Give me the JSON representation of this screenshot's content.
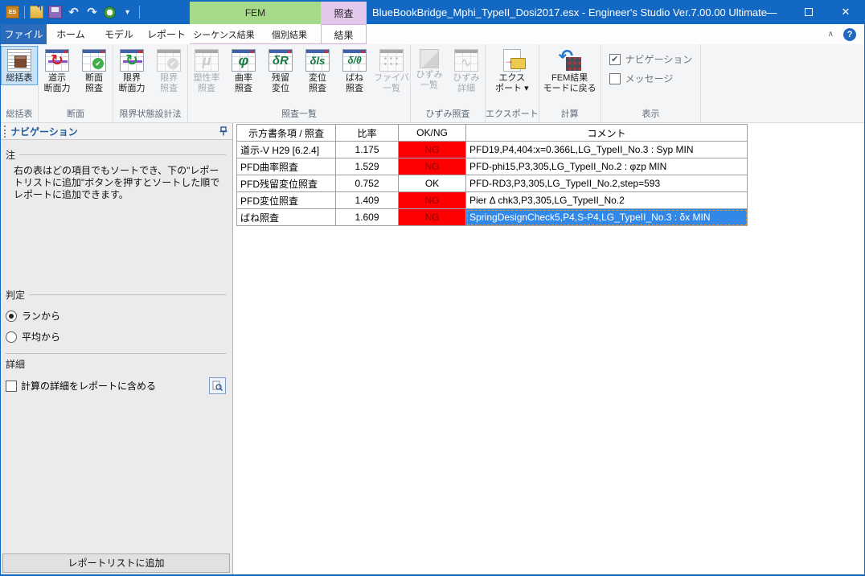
{
  "window": {
    "title": "BlueBookBridge_Mphi_TypeII_Dosi2017.esx - Engineer's Studio Ver.7.00.00 Ultimate",
    "controls": [
      "minimize-button",
      "maximize-button",
      "close-button"
    ]
  },
  "colors": {
    "title_bar": "#1268C2",
    "fem_tab_green": "#A6DA8B",
    "kensa_tab_purple": "#E2C8EA",
    "ng_bg": "#FF0000",
    "ng_text": "#8B0000",
    "selected_cell_bg": "#3188E6",
    "selected_cell_border": "#D98E35"
  },
  "quick_access": {
    "icons": [
      "app-logo-icon",
      "open-file-icon",
      "save-icon",
      "undo-icon",
      "redo-icon",
      "performance-icon",
      "qat-dropdown-icon"
    ]
  },
  "context_tabs": {
    "fem": "FEM",
    "kensa": "照査"
  },
  "tabstrip": {
    "tabs": [
      {
        "label": "ファイル",
        "style": "file"
      },
      {
        "label": "ホーム",
        "style": "normal"
      },
      {
        "label": "モデル",
        "style": "normal"
      },
      {
        "label": "レポート",
        "style": "normal"
      },
      {
        "label": "シーケンス結果",
        "style": "ctx"
      },
      {
        "label": "個別結果",
        "style": "ctx"
      },
      {
        "label": "結果",
        "style": "selected"
      }
    ],
    "collapse_chevron": "∧",
    "help": "?"
  },
  "ribbon": {
    "groups": [
      {
        "label": "総括表",
        "buttons": [
          {
            "label": "総括表",
            "icon": "summary-table-icon",
            "state": "selected"
          }
        ]
      },
      {
        "label": "断面",
        "buttons": [
          {
            "label": "道示\n断面力",
            "icon": "cycle-red-icon",
            "glyph": "↻"
          },
          {
            "label": "断面\n照査",
            "icon": "check-green-icon"
          }
        ]
      },
      {
        "label": "限界状態設計法",
        "buttons": [
          {
            "label": "限界\n断面力",
            "icon": "cycle-green-icon",
            "glyph": "↻"
          },
          {
            "label": "限界\n照査",
            "icon": "check-gray-icon",
            "state": "disabled"
          }
        ]
      },
      {
        "label": "照査一覧",
        "buttons": [
          {
            "label": "塑性率\n照査",
            "icon": "mu-icon",
            "glyph": "μ",
            "state": "disabled"
          },
          {
            "label": "曲率\n照査",
            "icon": "phi-icon",
            "glyph": "φ"
          },
          {
            "label": "残留\n変位",
            "icon": "delta-r-icon",
            "glyph": "δR"
          },
          {
            "label": "変位\n照査",
            "icon": "delta-ls-icon",
            "glyph": "δls"
          },
          {
            "label": "ばね\n照査",
            "icon": "delta-theta-icon",
            "glyph": "δ/θ"
          },
          {
            "label": "ファイバ\n一覧",
            "icon": "fiber-list-icon",
            "state": "disabled"
          }
        ]
      },
      {
        "label": "ひずみ照査",
        "buttons": [
          {
            "label": "ひずみ\n一覧",
            "icon": "strain-list-icon",
            "state": "disabled"
          },
          {
            "label": "ひずみ\n詳細",
            "icon": "strain-detail-icon",
            "state": "disabled"
          }
        ]
      },
      {
        "label": "エクスポート",
        "buttons": [
          {
            "label": "エクス\nポート ▾",
            "icon": "export-icon"
          }
        ]
      },
      {
        "label": "計算",
        "buttons": [
          {
            "label": "FEM結果\nモードに戻る",
            "icon": "fem-return-icon",
            "wide": true
          }
        ]
      },
      {
        "label": "表示",
        "checkboxes": [
          {
            "label": "ナビゲーション",
            "checked": true
          },
          {
            "label": "メッセージ",
            "checked": false
          }
        ]
      }
    ]
  },
  "nav": {
    "title": "ナビゲーション",
    "note_label": "注",
    "note_text": "右の表はどの項目でもソートでき、下の\"レポートリストに追加\"ボタンを押すとソートした順でレポートに追加できます。",
    "hantei": {
      "label": "判定",
      "options": [
        {
          "label": "ランから",
          "selected": true
        },
        {
          "label": "平均から",
          "selected": false
        }
      ]
    },
    "detail": {
      "label": "詳細",
      "checkbox_label": "計算の詳細をレポートに含める",
      "checked": false
    },
    "add_button": "レポートリストに追加"
  },
  "table": {
    "headers": [
      "示方書条項 / 照査",
      "比率",
      "OK/NG",
      "コメント"
    ],
    "rows": [
      {
        "name": "道示-V H29 [6.2.4]",
        "ratio": "1.175",
        "result": "NG",
        "comment": "PFD19,P4,404:x=0.366L,LG_TypeII_No.3 : Syp MIN",
        "selected": false
      },
      {
        "name": "PFD曲率照査",
        "ratio": "1.529",
        "result": "NG",
        "comment": "PFD-phi15,P3,305,LG_TypeII_No.2 : φzp MIN",
        "selected": false
      },
      {
        "name": "PFD残留変位照査",
        "ratio": "0.752",
        "result": "OK",
        "comment": "PFD-RD3,P3,305,LG_TypeII_No.2,step=593",
        "selected": false
      },
      {
        "name": "PFD変位照査",
        "ratio": "1.409",
        "result": "NG",
        "comment": "Pier Δ chk3,P3,305,LG_TypeII_No.2",
        "selected": false
      },
      {
        "name": "ばね照査",
        "ratio": "1.609",
        "result": "NG",
        "comment": "SpringDesignCheck5,P4,S-P4,LG_TypeII_No.3 : δx MIN",
        "selected": true
      }
    ]
  }
}
